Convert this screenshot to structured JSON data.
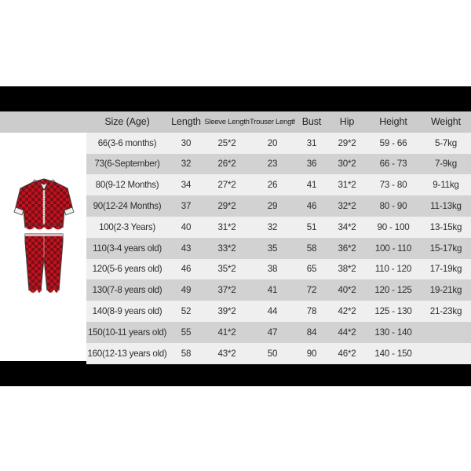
{
  "page": {
    "background_color": "#ffffff",
    "band_color": "#000000",
    "panel_color": "#ffffff",
    "header_row_color": "#cccccc",
    "row_light_color": "#efefef",
    "row_dark_color": "#d2d2d2",
    "text_color": "#2b2b2b"
  },
  "product": {
    "icon_name": "plaid-pajama-set",
    "description": "Red and black buffalo plaid child pajama set with white ruffle trim",
    "colors": {
      "plaid_red": "#c1121f",
      "plaid_dark": "#1a1212",
      "trim_white": "#f2f0ee",
      "outline": "#3b3b3b"
    }
  },
  "chart_data": {
    "type": "table",
    "title": "Size (Age)",
    "columns": [
      "Size (Age)",
      "Length",
      "Sleeve Length",
      "Trouser Length",
      "Bust",
      "Hip",
      "Height",
      "Weight"
    ],
    "rows": [
      [
        "66(3-6 months)",
        "30",
        "25*2",
        "20",
        "31",
        "29*2",
        "59 - 66",
        "5-7kg"
      ],
      [
        "73(6-September)",
        "32",
        "26*2",
        "23",
        "36",
        "30*2",
        "66 - 73",
        "7-9kg"
      ],
      [
        "80(9-12 Months)",
        "34",
        "27*2",
        "26",
        "41",
        "31*2",
        "73 - 80",
        "9-11kg"
      ],
      [
        "90(12-24 Months)",
        "37",
        "29*2",
        "29",
        "46",
        "32*2",
        "80 - 90",
        "11-13kg"
      ],
      [
        "100(2-3 Years)",
        "40",
        "31*2",
        "32",
        "51",
        "34*2",
        "90 - 100",
        "13-15kg"
      ],
      [
        "110(3-4 years old)",
        "43",
        "33*2",
        "35",
        "58",
        "36*2",
        "100 - 110",
        "15-17kg"
      ],
      [
        "120(5-6 years old)",
        "46",
        "35*2",
        "38",
        "65",
        "38*2",
        "110 - 120",
        "17-19kg"
      ],
      [
        "130(7-8 years old)",
        "49",
        "37*2",
        "41",
        "72",
        "40*2",
        "120 - 125",
        "19-21kg"
      ],
      [
        "140(8-9 years old)",
        "52",
        "39*2",
        "44",
        "78",
        "42*2",
        "125 - 130",
        "21-23kg"
      ],
      [
        "150(10-11 years old)",
        "55",
        "41*2",
        "47",
        "84",
        "44*2",
        "130 - 140",
        ""
      ],
      [
        "160(12-13 years old)",
        "58",
        "43*2",
        "50",
        "90",
        "46*2",
        "140 - 150",
        ""
      ]
    ]
  }
}
